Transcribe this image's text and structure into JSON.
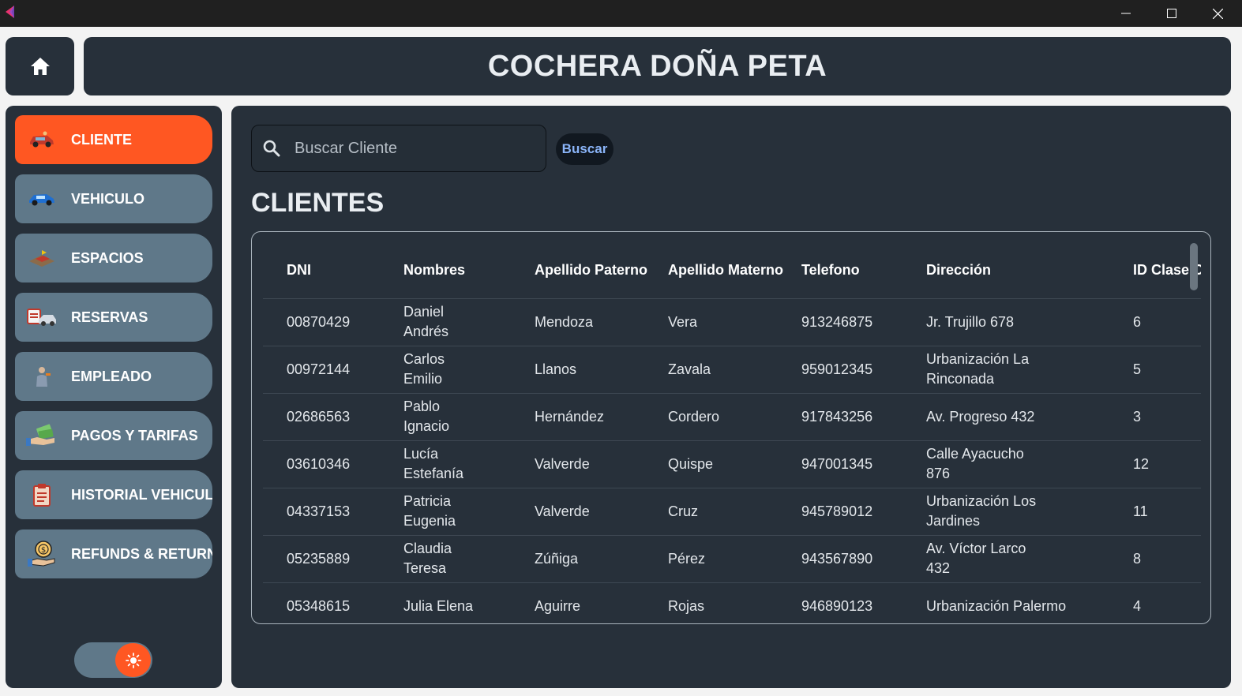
{
  "window": {
    "minimize_icon": "minimize-icon",
    "maximize_icon": "maximize-icon",
    "close_icon": "close-icon"
  },
  "header": {
    "title": "COCHERA DOÑA PETA",
    "home_icon": "home-icon"
  },
  "sidebar": {
    "items": [
      {
        "label": "CLIENTE",
        "icon": "customer-car-icon",
        "active": true
      },
      {
        "label": "VEHICULO",
        "icon": "car-icon",
        "active": false
      },
      {
        "label": "ESPACIOS",
        "icon": "parking-space-icon",
        "active": false
      },
      {
        "label": "RESERVAS",
        "icon": "reservation-icon",
        "active": false
      },
      {
        "label": "EMPLEADO",
        "icon": "employee-icon",
        "active": false
      },
      {
        "label": "PAGOS Y TARIFAS",
        "icon": "payment-icon",
        "active": false
      },
      {
        "label": "HISTORIAL VEHICULOS",
        "icon": "history-clipboard-icon",
        "active": false
      },
      {
        "label": "REFUNDS & RETURNS",
        "icon": "refund-icon",
        "active": false
      }
    ],
    "theme_toggle": {
      "icon": "sun-icon",
      "state": "light"
    }
  },
  "search": {
    "placeholder": "Buscar Cliente",
    "value": "",
    "button_label": "Buscar"
  },
  "section": {
    "title": "CLIENTES"
  },
  "table": {
    "columns": [
      "DNI",
      "Nombres",
      "Apellido Paterno",
      "Apellido Materno",
      "Telefono",
      "Dirección",
      "ID Clase Cliente"
    ],
    "rows": [
      [
        "00870429",
        "Daniel Andrés",
        "Mendoza",
        "Vera",
        "913246875",
        "Jr. Trujillo 678",
        "6"
      ],
      [
        "00972144",
        "Carlos Emilio",
        "Llanos",
        "Zavala",
        "959012345",
        "Urbanización La Rinconada",
        "5"
      ],
      [
        "02686563",
        "Pablo Ignacio",
        "Hernández",
        "Cordero",
        "917843256",
        "Av. Progreso 432",
        "3"
      ],
      [
        "03610346",
        "Lucía Estefanía",
        "Valverde",
        "Quispe",
        "947001345",
        "Calle Ayacucho 876",
        "12"
      ],
      [
        "04337153",
        "Patricia Eugenia",
        "Valverde",
        "Cruz",
        "945789012",
        "Urbanización Los Jardines",
        "11"
      ],
      [
        "05235889",
        "Claudia Teresa",
        "Zúñiga",
        "Pérez",
        "943567890",
        "Av. Víctor Larco 432",
        "8"
      ],
      [
        "05348615",
        "Julia Elena",
        "Aguirre",
        "Rojas",
        "946890123",
        "Urbanización Palermo",
        "4"
      ]
    ]
  },
  "colors": {
    "accent": "#ff5722",
    "panel": "#27303a",
    "nav_item": "#5f7889",
    "link": "#8ab4f8"
  }
}
